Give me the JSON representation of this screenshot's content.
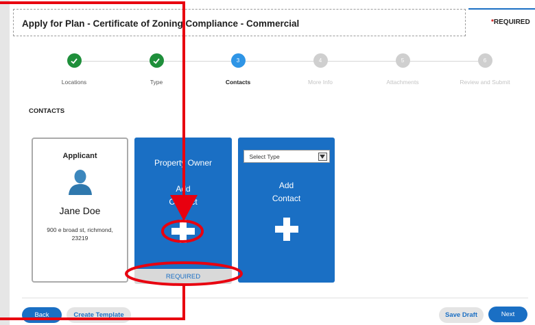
{
  "header": {
    "title": "Apply for Plan - Certificate of Zoning Compliance - Commercial",
    "required_note": "REQUIRED",
    "required_star": "*"
  },
  "stepper": {
    "steps": [
      {
        "number": "1",
        "label": "Locations",
        "state": "done"
      },
      {
        "number": "2",
        "label": "Type",
        "state": "done"
      },
      {
        "number": "3",
        "label": "Contacts",
        "state": "active"
      },
      {
        "number": "4",
        "label": "More Info",
        "state": "todo"
      },
      {
        "number": "5",
        "label": "Attachments",
        "state": "todo"
      },
      {
        "number": "6",
        "label": "Review and Submit",
        "state": "todo"
      }
    ]
  },
  "contacts": {
    "section_title": "CONTACTS",
    "applicant": {
      "role": "Applicant",
      "name": "Jane Doe",
      "address": "900 e broad st, richmond, 23219",
      "avatar_icon": "person-icon"
    },
    "property_owner": {
      "role": "Property Owner",
      "add_line1": "Add",
      "add_line2": "Contact",
      "required_label": "REQUIRED"
    },
    "new_contact": {
      "select_placeholder": "Select Type",
      "add_line1": "Add",
      "add_line2": "Contact"
    }
  },
  "footer": {
    "back_label": "Back",
    "create_template_label": "Create Template",
    "save_draft_label": "Save Draft",
    "next_label": "Next"
  },
  "colors": {
    "accent": "#1a6fc4",
    "done": "#1f8f3b",
    "active_step": "#2f95e6",
    "annotation": "#e8000f"
  }
}
